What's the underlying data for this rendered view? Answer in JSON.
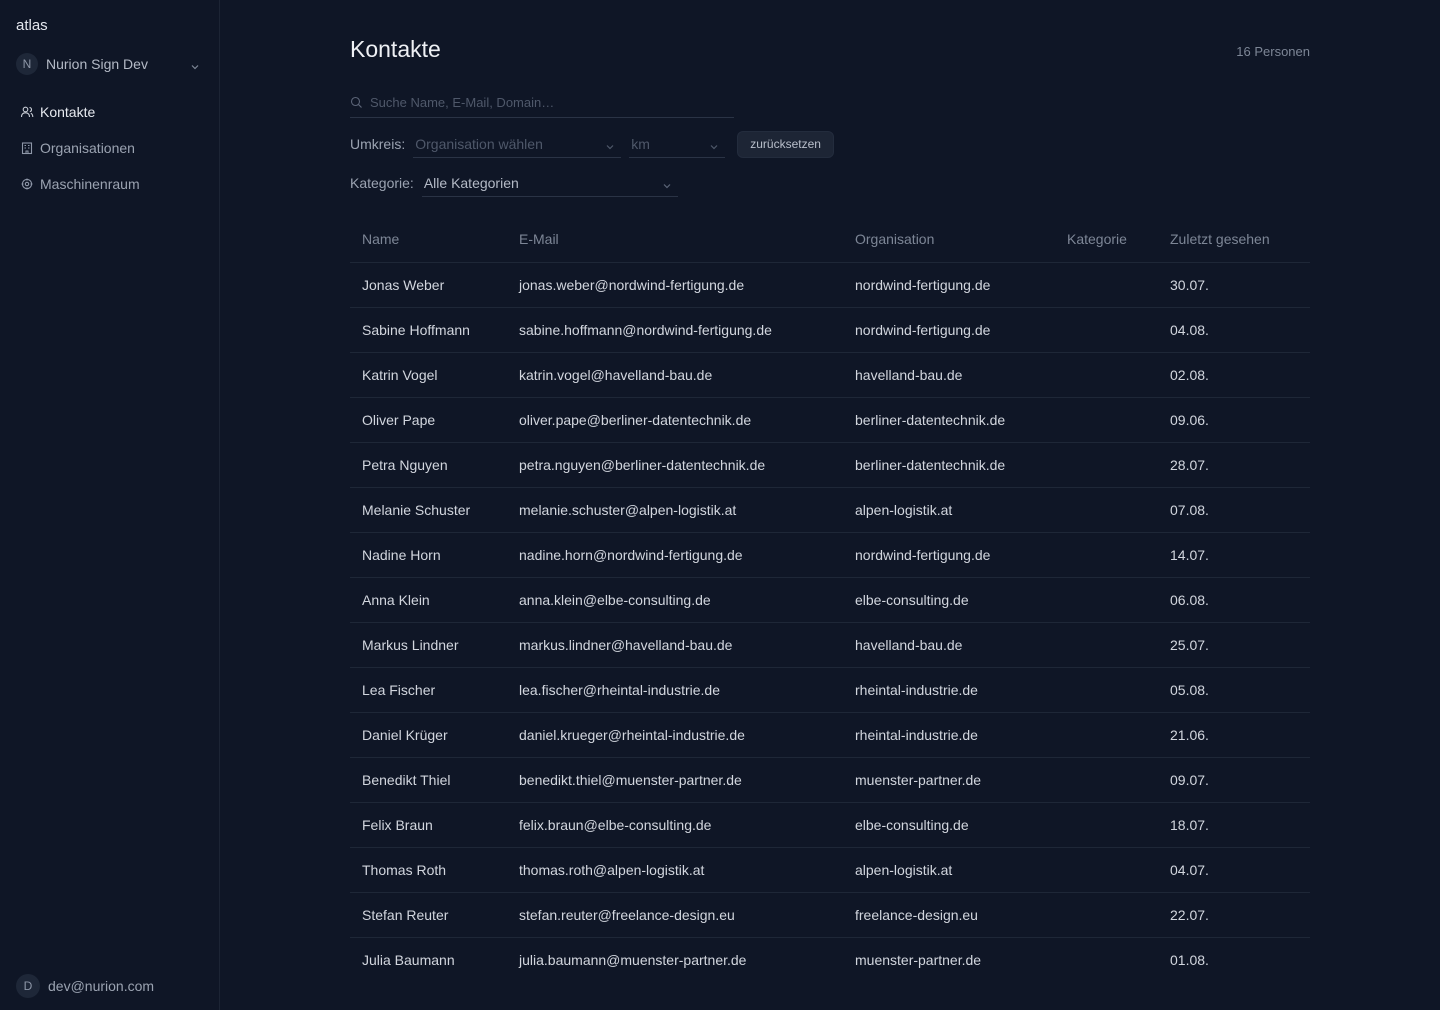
{
  "sidebar": {
    "brand": "atlas",
    "workspace": {
      "initial": "N",
      "name": "Nurion Sign Dev"
    },
    "nav": [
      {
        "label": "Kontakte",
        "icon": "users-icon",
        "active": true
      },
      {
        "label": "Organisationen",
        "icon": "building-icon",
        "active": false
      },
      {
        "label": "Maschinenraum",
        "icon": "gear-icon",
        "active": false
      }
    ],
    "user": {
      "initial": "D",
      "email": "dev@nurion.com"
    }
  },
  "main": {
    "title": "Kontakte",
    "count": "16 Personen",
    "search": {
      "placeholder": "Suche Name, E-Mail, Domain…"
    },
    "filters": {
      "radius_label": "Umkreis:",
      "org_placeholder": "Organisation wählen",
      "km_placeholder": "km",
      "reset_label": "zurücksetzen",
      "category_label": "Kategorie:",
      "category_value": "Alle Kategorien"
    },
    "table": {
      "columns": [
        "Name",
        "E-Mail",
        "Organisation",
        "Kategorie",
        "Zuletzt gesehen"
      ],
      "rows": [
        [
          "Jonas Weber",
          "jonas.weber@nordwind-fertigung.de",
          "nordwind-fertigung.de",
          "",
          "30.07."
        ],
        [
          "Sabine Hoffmann",
          "sabine.hoffmann@nordwind-fertigung.de",
          "nordwind-fertigung.de",
          "",
          "04.08."
        ],
        [
          "Katrin Vogel",
          "katrin.vogel@havelland-bau.de",
          "havelland-bau.de",
          "",
          "02.08."
        ],
        [
          "Oliver Pape",
          "oliver.pape@berliner-datentechnik.de",
          "berliner-datentechnik.de",
          "",
          "09.06."
        ],
        [
          "Petra Nguyen",
          "petra.nguyen@berliner-datentechnik.de",
          "berliner-datentechnik.de",
          "",
          "28.07."
        ],
        [
          "Melanie Schuster",
          "melanie.schuster@alpen-logistik.at",
          "alpen-logistik.at",
          "",
          "07.08."
        ],
        [
          "Nadine Horn",
          "nadine.horn@nordwind-fertigung.de",
          "nordwind-fertigung.de",
          "",
          "14.07."
        ],
        [
          "Anna Klein",
          "anna.klein@elbe-consulting.de",
          "elbe-consulting.de",
          "",
          "06.08."
        ],
        [
          "Markus Lindner",
          "markus.lindner@havelland-bau.de",
          "havelland-bau.de",
          "",
          "25.07."
        ],
        [
          "Lea Fischer",
          "lea.fischer@rheintal-industrie.de",
          "rheintal-industrie.de",
          "",
          "05.08."
        ],
        [
          "Daniel Krüger",
          "daniel.krueger@rheintal-industrie.de",
          "rheintal-industrie.de",
          "",
          "21.06."
        ],
        [
          "Benedikt Thiel",
          "benedikt.thiel@muenster-partner.de",
          "muenster-partner.de",
          "",
          "09.07."
        ],
        [
          "Felix Braun",
          "felix.braun@elbe-consulting.de",
          "elbe-consulting.de",
          "",
          "18.07."
        ],
        [
          "Thomas Roth",
          "thomas.roth@alpen-logistik.at",
          "alpen-logistik.at",
          "",
          "04.07."
        ],
        [
          "Stefan Reuter",
          "stefan.reuter@freelance-design.eu",
          "freelance-design.eu",
          "",
          "22.07."
        ],
        [
          "Julia Baumann",
          "julia.baumann@muenster-partner.de",
          "muenster-partner.de",
          "",
          "01.08."
        ]
      ]
    }
  }
}
